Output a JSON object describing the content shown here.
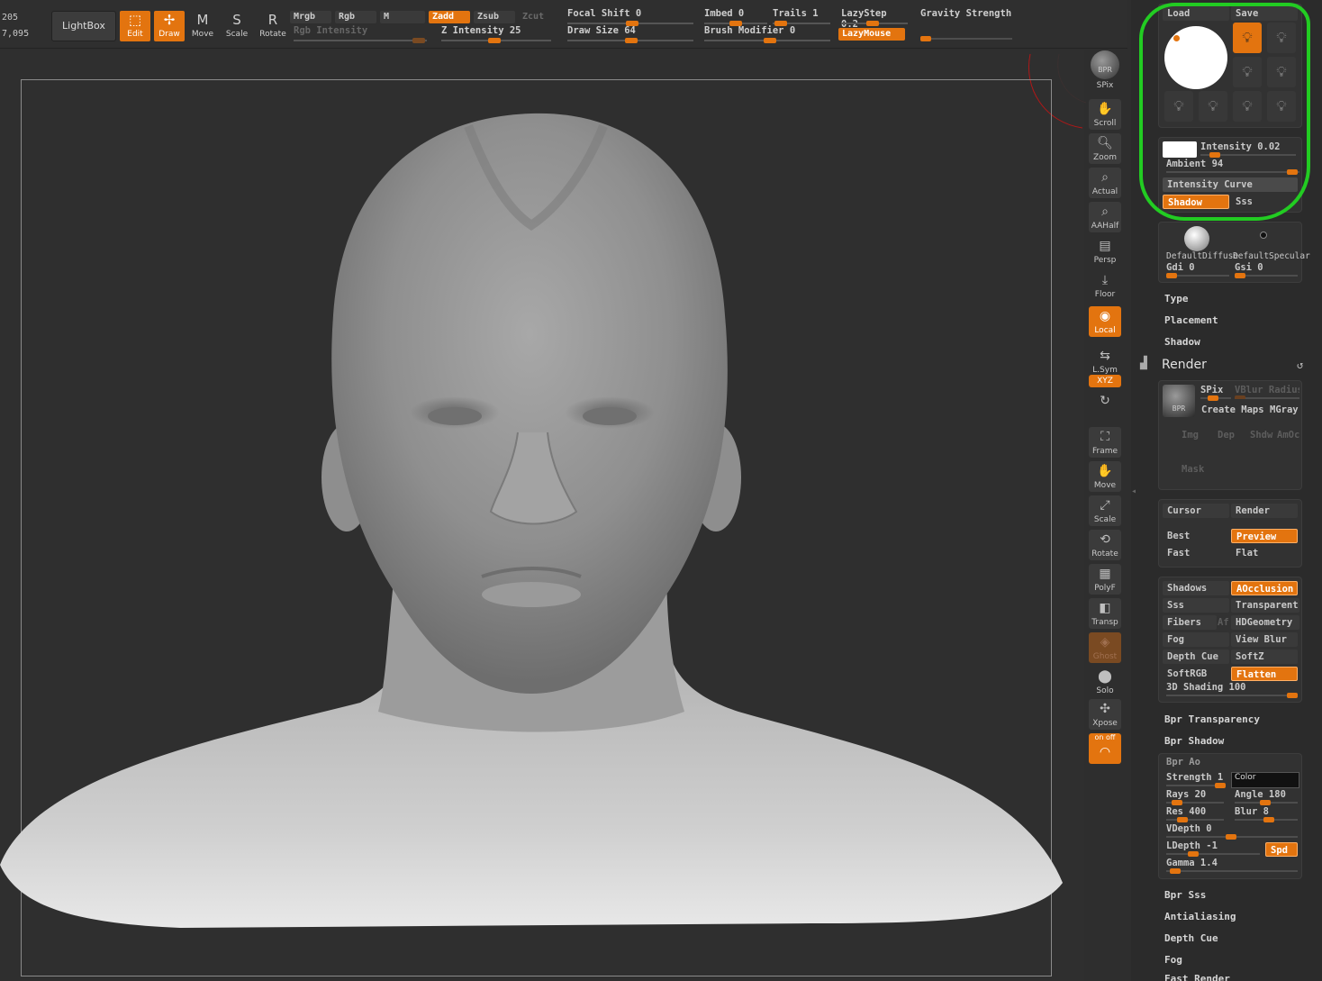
{
  "coords": {
    "line1": "205",
    "line2": "7,095"
  },
  "toolbar": {
    "lightbox": "LightBox",
    "edit": "Edit",
    "draw": "Draw",
    "move": "Move",
    "scale": "Scale",
    "rotate": "Rotate",
    "move_glyph": "M",
    "scale_glyph": "S",
    "rotate_glyph": "R",
    "mrgb": "Mrgb",
    "rgb": "Rgb",
    "m": "M",
    "rgb_intensity": "Rgb Intensity",
    "zadd": "Zadd",
    "zsub": "Zsub",
    "zcut": "Zcut",
    "z_intensity": "Z Intensity 25",
    "focal_shift": "Focal Shift 0",
    "draw_size": "Draw Size 64",
    "imbed": "Imbed 0",
    "trails": "Trails 1",
    "brush_modifier": "Brush Modifier 0",
    "lazystep": "LazyStep 0.2",
    "lazymouse": "LazyMouse",
    "gravity": "Gravity Strength"
  },
  "shelf": {
    "bpr": "BPR",
    "spix": "SPix",
    "scroll": "Scroll",
    "zoom": "Zoom",
    "actual": "Actual",
    "aahalf": "AAHalf",
    "persp": "Persp",
    "floor": "Floor",
    "local": "Local",
    "lsym": "L.Sym",
    "xyz": "XYZ",
    "frame": "Frame",
    "move": "Move",
    "scale": "Scale",
    "rotate": "Rotate",
    "polyf": "PolyF",
    "transp": "Transp",
    "ghost": "Ghost",
    "solo": "Solo",
    "xpose": "Xpose",
    "onoff": "on  off"
  },
  "light": {
    "load": "Load",
    "save": "Save",
    "intensity": "Intensity 0.02",
    "ambient": "Ambient 94",
    "intensity_curve": "Intensity Curve",
    "shadow": "Shadow",
    "sss": "Sss"
  },
  "material": {
    "diffuse": "DefaultDiffuse",
    "specular": "DefaultSpecular",
    "gdi": "Gdi 0",
    "gsi": "Gsi 0"
  },
  "light_sections": [
    "Type",
    "Placement",
    "Shadow"
  ],
  "render": {
    "title": "Render",
    "bpr_label": "BPR",
    "spix": "SPix",
    "vblur": "VBlur Radius",
    "create_maps": "Create Maps",
    "mgray": "MGray",
    "img": "Img",
    "dep": "Dep",
    "shdw": "Shdw",
    "amoc": "AmOc",
    "mask": "Mask",
    "cursor": "Cursor",
    "render": "Render",
    "best": "Best",
    "preview": "Preview",
    "fast": "Fast",
    "flat": "Flat",
    "shadows": "Shadows",
    "aocclusion": "AOcclusion",
    "sss": "Sss",
    "transparent": "Transparent",
    "fibers": "Fibers",
    "af": "Af",
    "hdgeometry": "HDGeometry",
    "fog": "Fog",
    "view_blur": "View Blur",
    "depth_cue": "Depth Cue",
    "softz": "SoftZ",
    "softrgb": "SoftRGB",
    "flatten": "Flatten",
    "shading": "3D Shading 100",
    "bpr_transparency": "Bpr Transparency",
    "bpr_shadow": "Bpr Shadow",
    "bpr_ao": "Bpr Ao",
    "strength": "Strength 1",
    "color": "Color",
    "rays": "Rays 20",
    "angle": "Angle 180",
    "res": "Res 400",
    "blur": "Blur 8",
    "vdepth": "VDepth 0",
    "ldepth": "LDepth -1",
    "spd": "Spd",
    "gamma": "Gamma 1.4",
    "bpr_sss": "Bpr Sss",
    "antialiasing": "Antialiasing",
    "depth_cue_section": "Depth Cue",
    "fog_section": "Fog",
    "fast_render": "Fast Render"
  },
  "colors": {
    "accent": "#e3740f",
    "highlight_ring": "#22cc22"
  }
}
